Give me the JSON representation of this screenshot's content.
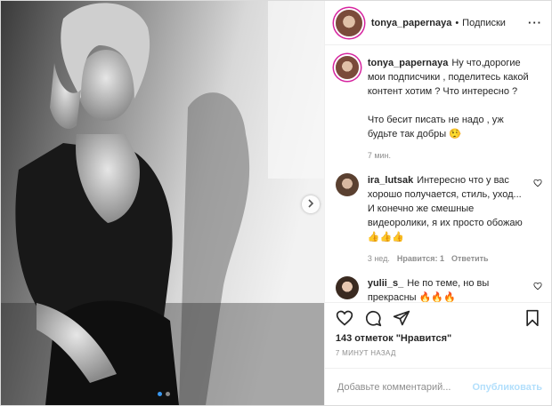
{
  "header": {
    "username": "tonya_papernaya",
    "separator": "•",
    "follow_label": "Подписки",
    "more_icon": "more-dots-icon"
  },
  "caption": {
    "username": "tonya_papernaya",
    "text": "Ну что,дорогие мои подписчики , поделитесь какой контент хотим ? Что интересно ?\n\nЧто бесит писать не надо , уж будьте так добры 🤥",
    "time": "7 мин."
  },
  "comments": [
    {
      "username": "ira_lutsak",
      "text": "Интересно что у вас хорошо получается, стиль, уход... И конечно же смешные видеоролики, я их просто обожаю 👍👍👍",
      "time": "3 нед.",
      "likes": "Нравится: 1",
      "reply": "Ответить"
    },
    {
      "username": "yulii_s_",
      "text": "Не по теме, но вы прекрасны 🔥🔥🔥"
    }
  ],
  "actions": {
    "likes_text": "143 отметок \"Нравится\"",
    "timestamp": "7 МИНУТ НАЗАД"
  },
  "add_comment": {
    "placeholder": "Добавьте комментарий...",
    "post_label": "Опубликовать"
  },
  "carousel": {
    "current_index": 1,
    "count": 2
  },
  "colors": {
    "accent": "#3897f0",
    "text": "#262626",
    "muted": "#8e8e8e",
    "post_disabled": "#b2dffc"
  }
}
